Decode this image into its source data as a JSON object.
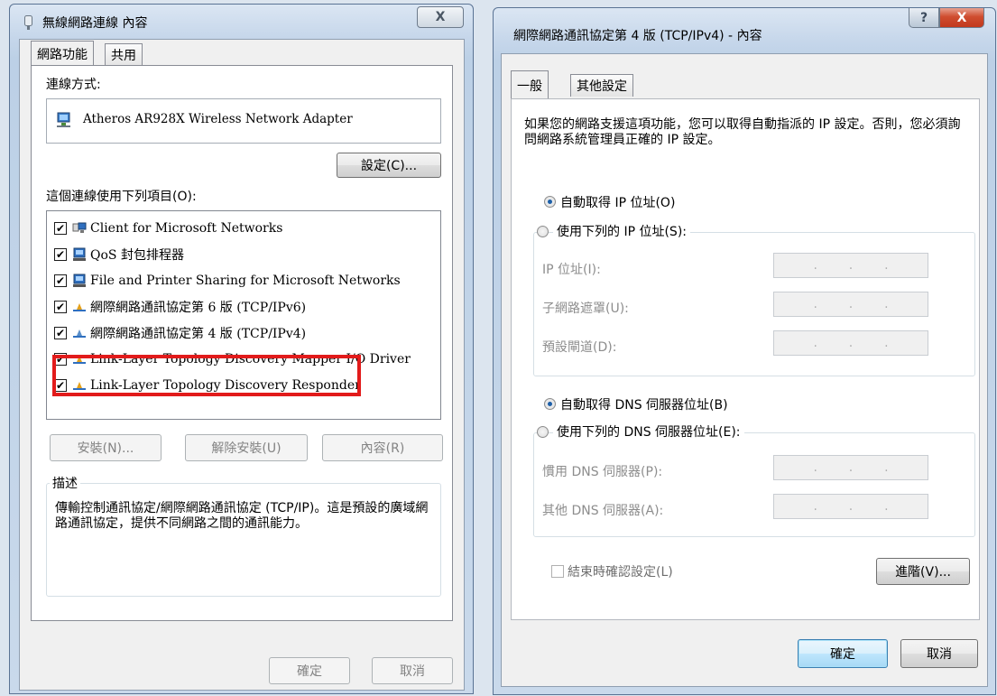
{
  "left_window": {
    "title": "無線網路連線 內容",
    "close_glyph": "X",
    "tabs": [
      {
        "label": "網路功能"
      },
      {
        "label": "共用"
      }
    ],
    "connect_using_label": "連線方式:",
    "adapter_name": "Atheros AR928X Wireless Network Adapter",
    "configure_button": "設定(C)...",
    "items_label": "這個連線使用下列項目(O):",
    "items": [
      {
        "label": "Client for Microsoft Networks",
        "checked": "✔",
        "icon": "network-client-icon"
      },
      {
        "label": "QoS 封包排程器",
        "checked": "✔",
        "icon": "qos-scheduler-icon"
      },
      {
        "label": "File and Printer Sharing for Microsoft Networks",
        "checked": "✔",
        "icon": "file-printer-sharing-icon"
      },
      {
        "label": "網際網路通訊協定第 6 版 (TCP/IPv6)",
        "checked": "✔",
        "icon": "protocol-icon"
      },
      {
        "label": "網際網路通訊協定第 4 版 (TCP/IPv4)",
        "checked": "✔",
        "icon": "protocol-icon"
      },
      {
        "label": "Link-Layer Topology Discovery Mapper I/O Driver",
        "checked": "✔",
        "icon": "protocol-icon"
      },
      {
        "label": "Link-Layer Topology Discovery Responder",
        "checked": "✔",
        "icon": "protocol-icon"
      }
    ],
    "install_button": "安裝(N)...",
    "uninstall_button": "解除安裝(U)",
    "properties_button": "內容(R)",
    "description_title": "描述",
    "description_text": "傳輸控制通訊協定/網際網路通訊協定 (TCP/IP)。這是預設的廣域網路通訊協定，提供不同網路之間的通訊能力。",
    "ok_button": "確定",
    "cancel_button": "取消"
  },
  "right_window": {
    "title": "網際網路通訊協定第 4 版 (TCP/IPv4) - 內容",
    "help_glyph": "?",
    "close_glyph": "X",
    "tabs": [
      {
        "label": "一般"
      },
      {
        "label": "其他設定"
      }
    ],
    "intro_text": "如果您的網路支援這項功能，您可以取得自動指派的 IP 設定。否則，您必須詢問網路系統管理員正確的 IP 設定。",
    "auto_ip_label": "自動取得 IP 位址(O)",
    "manual_ip_label": "使用下列的 IP 位址(S):",
    "ip_address_label": "IP 位址(I):",
    "subnet_mask_label": "子網路遮罩(U):",
    "default_gateway_label": "預設閘道(D):",
    "auto_dns_label": "自動取得 DNS 伺服器位址(B)",
    "manual_dns_label": "使用下列的 DNS 伺服器位址(E):",
    "preferred_dns_label": "慣用 DNS 伺服器(P):",
    "alternate_dns_label": "其他 DNS 伺服器(A):",
    "validate_label": "結束時確認設定(L)",
    "advanced_button": "進階(V)...",
    "ok_button": "確定",
    "cancel_button": "取消",
    "ip_dots": "."
  },
  "colors": {
    "highlight": "#e21b1b",
    "radio_selected": "#1d5fa8",
    "close_button": "#c7462a"
  }
}
